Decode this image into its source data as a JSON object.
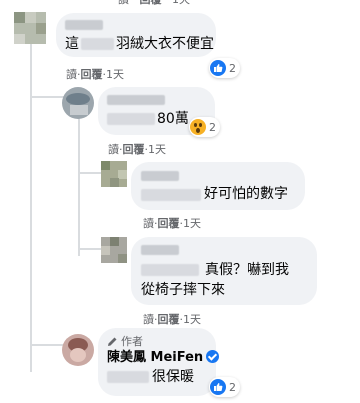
{
  "meta": {
    "read": "讀",
    "reply": "回覆",
    "sep": "·",
    "age": "1天"
  },
  "comments": [
    {
      "text_visible": "羽絨大衣不便宜",
      "text_prefix": "這",
      "reaction": {
        "type": "like",
        "count": "2"
      }
    },
    {
      "text_visible": "80萬",
      "reaction": {
        "type": "wow",
        "count": "2"
      }
    },
    {
      "text_visible": "好可怕的數字"
    },
    {
      "text_line1": "真假？嚇到我",
      "text_line2": "從椅子摔下來"
    },
    {
      "author_badge": "作者",
      "author_name": "陳美鳳 MeiFen",
      "text_visible": "很保暖",
      "reaction": {
        "type": "like",
        "count": "2"
      }
    }
  ],
  "colors": {
    "bubble": "#f0f2f5",
    "meta": "#65676b",
    "like": "#1877f2",
    "wow": "#f7b125"
  },
  "icons": [
    "like-icon",
    "wow-icon",
    "verified-badge-icon",
    "author-pen-icon"
  ]
}
